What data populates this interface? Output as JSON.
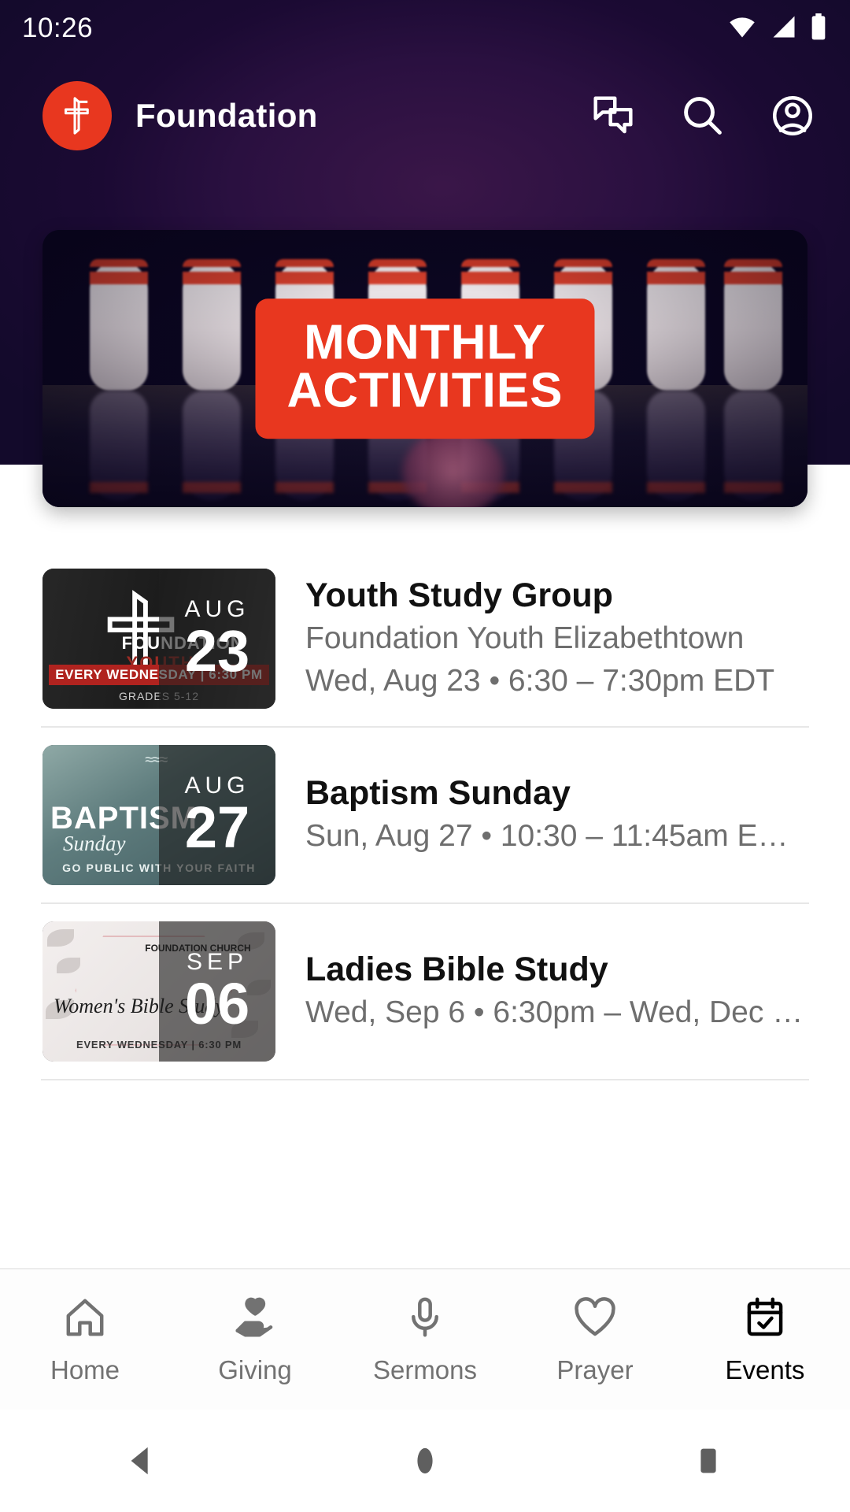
{
  "statusbar": {
    "time": "10:26",
    "icons": [
      "wifi-icon",
      "cellular-signal-icon",
      "battery-icon"
    ]
  },
  "appbar": {
    "logo_icon": "foundation-cross-logo-icon",
    "title": "Foundation",
    "actions": [
      {
        "name": "messages-icon",
        "label": "Messages"
      },
      {
        "name": "search-icon",
        "label": "Search"
      },
      {
        "name": "account-icon",
        "label": "Account"
      }
    ]
  },
  "banner": {
    "label_line1": "MONTHLY",
    "label_line2": "ACTIVITIES",
    "accent_color": "#E8371F",
    "image_description": "bowling pins"
  },
  "events": [
    {
      "title": "Youth Study Group",
      "location": "Foundation Youth Elizabethtown",
      "datetime": "Wed, Aug 23 • 6:30 – 7:30pm EDT",
      "date_month": "AUG",
      "date_day": "23",
      "thumb_kind": "youth",
      "thumb_text": {
        "brand_top": "FOUNDATION",
        "brand_bottom": "YOUTH",
        "bar": "EVERY WEDNESDAY | 6:30 PM",
        "grades": "GRADES 5-12"
      }
    },
    {
      "title": "Baptism Sunday",
      "location": "",
      "datetime": "Sun, Aug 27 • 10:30 – 11:45am E…",
      "date_month": "AUG",
      "date_day": "27",
      "thumb_kind": "baptism",
      "thumb_text": {
        "brand_top": "BAPTISM",
        "brand_bottom": "Sunday",
        "bar": "GO PUBLIC WITH YOUR FAITH",
        "grades": ""
      }
    },
    {
      "title": "Ladies Bible Study",
      "location": "",
      "datetime": "Wed, Sep 6 • 6:30pm – Wed, Dec …",
      "date_month": "SEP",
      "date_day": "06",
      "thumb_kind": "ladies",
      "thumb_text": {
        "brand_top": "FOUNDATION CHURCH",
        "brand_bottom": "Women's Bible Study",
        "bar": "EVERY WEDNESDAY | 6:30 PM",
        "grades": ""
      }
    }
  ],
  "bottom_nav": {
    "items": [
      {
        "label": "Home",
        "icon": "home-icon",
        "active": false
      },
      {
        "label": "Giving",
        "icon": "hand-heart-icon",
        "active": false
      },
      {
        "label": "Sermons",
        "icon": "microphone-icon",
        "active": false
      },
      {
        "label": "Prayer",
        "icon": "heart-icon",
        "active": false
      },
      {
        "label": "Events",
        "icon": "calendar-check-icon",
        "active": true
      }
    ],
    "active_color": "#000000",
    "inactive_color": "#727272"
  },
  "system_nav": {
    "buttons": [
      {
        "name": "back-button"
      },
      {
        "name": "home-button"
      },
      {
        "name": "recents-button"
      }
    ]
  }
}
